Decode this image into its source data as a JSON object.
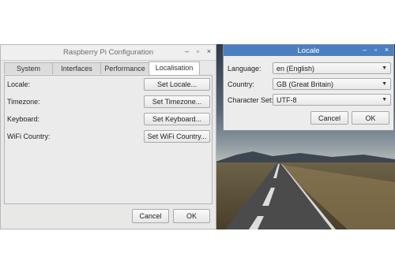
{
  "main_window": {
    "title": "Raspberry Pi Configuration",
    "controls": {
      "minimize": "–",
      "maximize": "▫",
      "close": "×"
    },
    "tabs": [
      {
        "label": "System",
        "active": false
      },
      {
        "label": "Interfaces",
        "active": false
      },
      {
        "label": "Performance",
        "active": false
      },
      {
        "label": "Localisation",
        "active": true
      }
    ],
    "rows": [
      {
        "label": "Locale:",
        "button": "Set Locale..."
      },
      {
        "label": "Timezone:",
        "button": "Set Timezone..."
      },
      {
        "label": "Keyboard:",
        "button": "Set Keyboard..."
      },
      {
        "label": "WiFi Country:",
        "button": "Set WiFi Country..."
      }
    ],
    "cancel_label": "Cancel",
    "ok_label": "OK"
  },
  "locale_dialog": {
    "title": "Locale",
    "controls": {
      "minimize": "–",
      "maximize": "▫",
      "close": "×"
    },
    "fields": [
      {
        "label": "Language:",
        "value": "en (English)"
      },
      {
        "label": "Country:",
        "value": "GB (Great Britain)"
      },
      {
        "label": "Character Set:",
        "value": "UTF-8"
      }
    ],
    "cancel_label": "Cancel",
    "ok_label": "OK"
  },
  "colors": {
    "locale_titlebar": "#4a7fc1",
    "window_bg": "#e8e8e7"
  }
}
